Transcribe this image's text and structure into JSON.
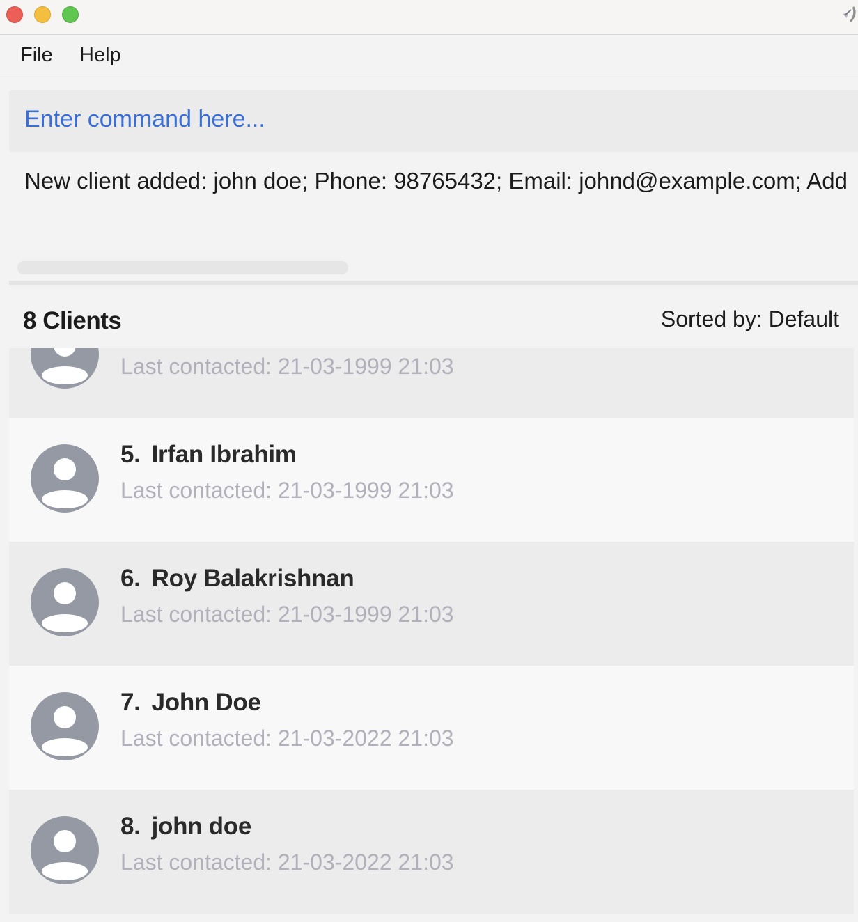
{
  "menu": {
    "file": "File",
    "help": "Help"
  },
  "command": {
    "placeholder": "Enter command here..."
  },
  "result": {
    "message": "New client added: john doe; Phone: 98765432; Email: johnd@example.com; Add"
  },
  "client_list": {
    "title": "8 Clients",
    "sorted_by": "Sorted by: Default",
    "clients": [
      {
        "index": "",
        "name": "",
        "last_contacted": "Last contacted: 21-03-1999 21:03"
      },
      {
        "index": "5.",
        "name": "Irfan Ibrahim",
        "last_contacted": "Last contacted: 21-03-1999 21:03"
      },
      {
        "index": "6.",
        "name": "Roy Balakrishnan",
        "last_contacted": "Last contacted: 21-03-1999 21:03"
      },
      {
        "index": "7.",
        "name": "John Doe",
        "last_contacted": "Last contacted: 21-03-2022 21:03"
      },
      {
        "index": "8.",
        "name": "john doe",
        "last_contacted": "Last contacted: 21-03-2022 21:03"
      }
    ]
  },
  "colors": {
    "close_button": "#ec5f57",
    "minimize_button": "#f4be3f",
    "maximize_button": "#5fc64f",
    "command_text": "#3a6fd8",
    "last_contacted_text": "#b2b0ba",
    "avatar": "#9599a4"
  },
  "icons": {
    "window_close": "close-icon",
    "window_minimize": "minimize-icon",
    "window_maximize": "maximize-icon",
    "app": "app-icon",
    "avatar": "avatar-icon"
  }
}
